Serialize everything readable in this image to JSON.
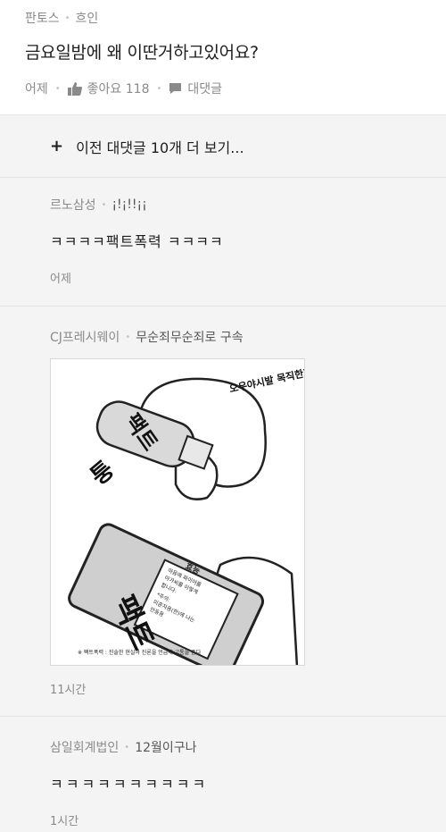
{
  "post": {
    "category": "판토스",
    "author": "흐인",
    "title": "금요일밤에 왜 이딴거하고있어요?",
    "time": "어제",
    "like_label": "좋아요 118",
    "comment_label": "대댓글"
  },
  "load_more": "이전 대댓글 10개 더 보기...",
  "comments": [
    {
      "author": "르노삼성",
      "extra": "¡!¡!!¡¡",
      "body": "ㅋㅋㅋㅋ팩트폭력 ㅋㅋㅋㅋ",
      "time": "어제"
    },
    {
      "author": "CJ프레시웨이",
      "extra": "무순죄무순죄로 구속",
      "time": "11시간",
      "image": {
        "top_label": "팩트",
        "sfx": "퉁",
        "shout": "오우야시발 목직한거봐소!",
        "bottle_label": "팩트",
        "sticker_title": "효능",
        "sticker_lines": [
          "마음에 파이어를",
          "아가씨를 이렇게",
          "합니다.",
          "*주의:",
          "미혼자용(한)에 나는",
          "안동용"
        ],
        "footnote": "※ 팩트폭력 : 진솔한 현실과 진론을 언급해 고통을 줌다"
      }
    },
    {
      "author": "삼일회계법인",
      "extra": "12월이구나",
      "body": "ㅋㅋㅋㅋㅋㅋㅋㅋㅋㅋ",
      "time": "1시간"
    }
  ]
}
